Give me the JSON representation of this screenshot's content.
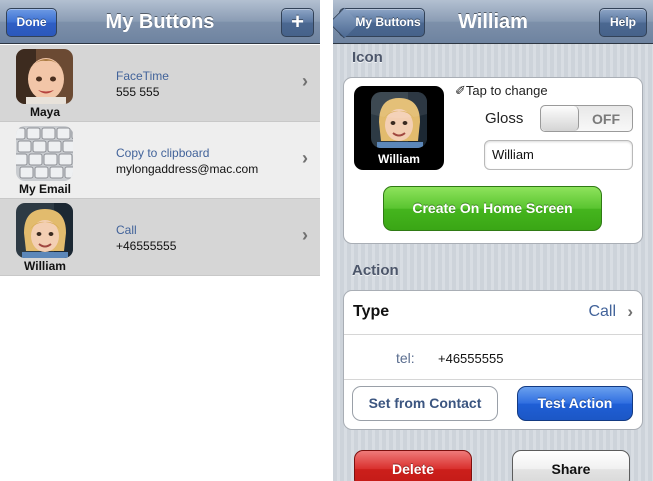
{
  "left": {
    "nav": {
      "done_label": "Done",
      "title": "My Buttons",
      "add_symbol": "+"
    },
    "rows": [
      {
        "caption": "Maya",
        "action": "FaceTime",
        "detail": "555 555",
        "icon": "baby-photo"
      },
      {
        "caption": "My Email",
        "action": "Copy to clipboard",
        "detail": "mylongaddress@mac.com",
        "icon": "keyboard-photo"
      },
      {
        "caption": "William",
        "action": "Call",
        "detail": "+46555555",
        "icon": "boy-photo"
      }
    ],
    "chevron": "›"
  },
  "right": {
    "nav": {
      "back_label": "My Buttons",
      "title": "William",
      "help_label": "Help"
    },
    "icon_section": {
      "label": "Icon",
      "tile_caption": "William",
      "tap_hint": "✐Tap to change",
      "gloss_label": "Gloss",
      "gloss_state": "OFF",
      "name_value": "William",
      "create_label": "Create On Home Screen"
    },
    "action_section": {
      "label": "Action",
      "type_key": "Type",
      "type_value": "Call",
      "tel_key": "tel:",
      "tel_value": "+46555555",
      "set_from_contact_label": "Set from Contact",
      "test_action_label": "Test Action"
    },
    "bottom": {
      "delete_label": "Delete",
      "share_label": "Share"
    }
  },
  "colors": {
    "nav_bar": "#8a9cb4",
    "accent_blue": "#2f6ee0",
    "create_green": "#45b51e",
    "delete_red": "#cc1f1b",
    "link_text": "#42639a"
  }
}
